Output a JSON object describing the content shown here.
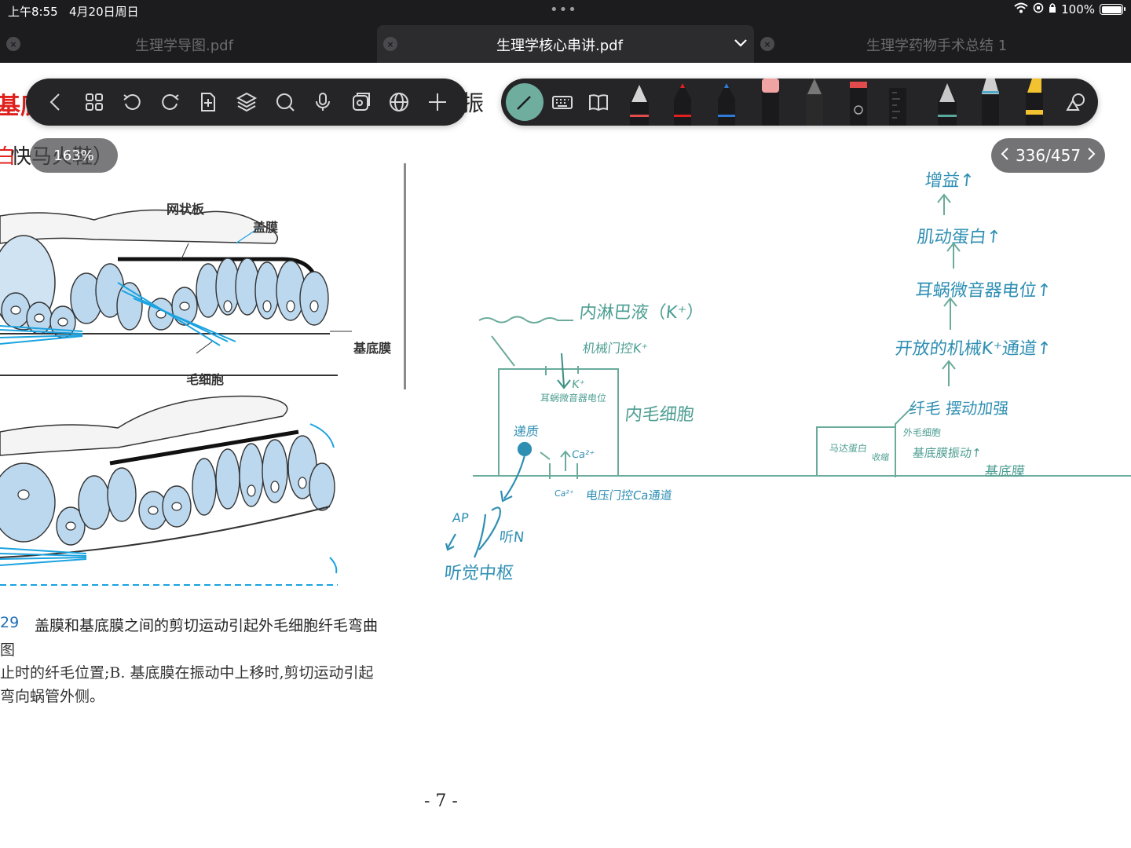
{
  "status_bar": {
    "time": "上午8:55",
    "date": "4月20日周日",
    "dots": "•••",
    "battery": "100%"
  },
  "tabs": [
    {
      "title": "生理学导图.pdf",
      "active": false
    },
    {
      "title": "生理学核心串讲.pdf",
      "active": true
    },
    {
      "title": "生理学药物手术总结 1",
      "active": false
    }
  ],
  "viewer": {
    "zoom": "163%",
    "page_indicator": "336/457"
  },
  "toolbar": {
    "left_icons": [
      "back-icon",
      "grid-icon",
      "undo-icon",
      "redo-icon",
      "add-page-icon",
      "layers-icon",
      "search-icon",
      "microphone-icon",
      "stickers-icon",
      "globe-icon",
      "plus-icon"
    ],
    "right_icons": [
      "pen-icon",
      "keyboard-icon",
      "book-icon",
      "fountain-pen-icon",
      "red-pen-icon",
      "blue-pen-icon",
      "pink-eraser-icon",
      "pencil-icon",
      "laser-pointer-icon",
      "ruler-icon",
      "teal-fountain-pen-icon",
      "teal-highlighter-icon",
      "yellow-highlighter-icon",
      "shapes-icon"
    ],
    "accent": "#6fae9f"
  },
  "document": {
    "heading_red": "基底",
    "heading_right": "振",
    "subheading_red": "白",
    "subheading_black": "快马火鞋）",
    "figure_labels": {
      "reticular": "网状板",
      "tectorial": "盖膜",
      "basilar": "基底膜",
      "hair_cell": "毛细胞"
    },
    "caption_number": "29",
    "caption_title": "盖膜和基底膜之间的剪切运动引起外毛细胞纤毛弯曲",
    "caption_lines": [
      "图",
      "止时的纤毛位置;B. 基底膜在振动中上移时,剪切运动引起",
      "弯向蜗管外侧。"
    ],
    "page_number": "- 7 -"
  },
  "handwriting": {
    "endolymph": "内淋巴液（K⁺）",
    "mech_gated": "机械门控K⁺",
    "k_plus": "K⁺",
    "receptor_potential": "耳蜗微音器电位",
    "inner_hair_cell": "内毛细胞",
    "transmitter": "递质",
    "ca": "Ca²⁺",
    "ca2": "Ca²⁺",
    "voltage_gated": "电压门控Ca通道",
    "ap": "AP",
    "auditory_nerve": "听N",
    "auditory_center": "听觉中枢",
    "gain": "增益↑",
    "motor_protein": "肌动蛋白↑",
    "mic_potential": "耳蜗微音器电位↑",
    "open_channels": "开放的机械K⁺通道↑",
    "cilia_swing": "纤毛 摆动加强",
    "outer_hair_cell": "外毛细胞",
    "prestin": "马达蛋白",
    "contract": "收缩",
    "basilar_vibration": "基底膜振动↑",
    "basilar_membrane": "基底膜",
    "lid": "盖膜"
  }
}
